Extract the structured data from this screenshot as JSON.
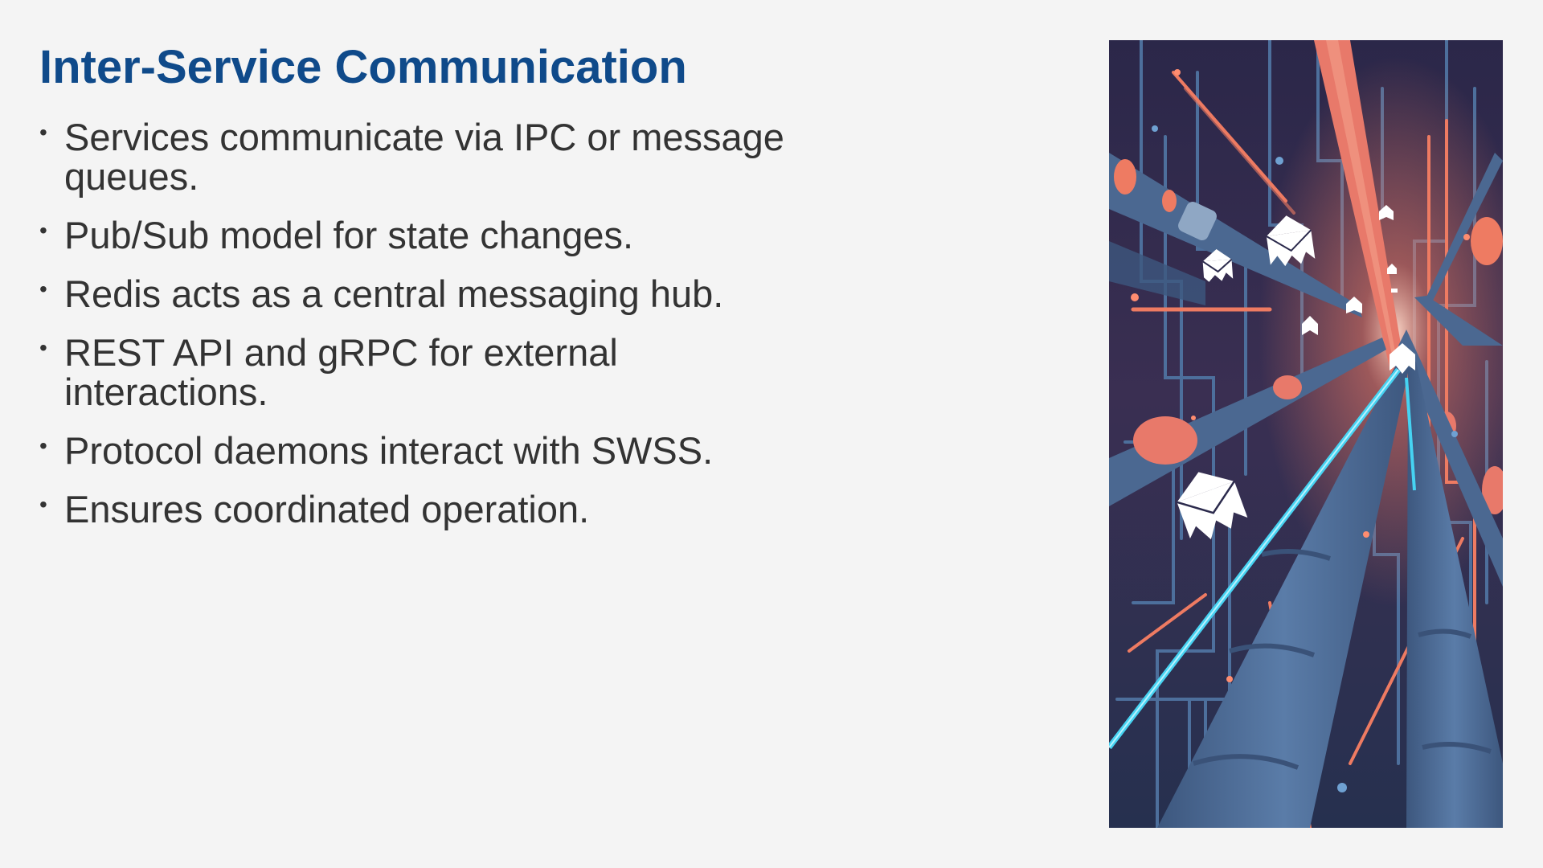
{
  "slide": {
    "title": "Inter-Service Communication",
    "bullets": [
      "Services communicate via IPC or message queues.",
      "Pub/Sub model for state changes.",
      "Redis acts as a central messaging hub.",
      "REST API and gRPC for external interactions.",
      "Protocol daemons interact with SWSS.",
      "Ensures coordinated operation."
    ],
    "bullet_glyph": "•"
  },
  "illustration": {
    "subject": "message envelopes flying through a tunnel of pipes and circuit traces",
    "icons": [
      "envelope-icon"
    ],
    "colors": {
      "background": "#2b2a4c",
      "pipe": "#52739f",
      "pipe_dark": "#3d577e",
      "trace": "#4d6f9c",
      "accent": "#ee7b62",
      "glow": "#46d3f2",
      "envelope": "#ffffff"
    }
  },
  "colors": {
    "page_background": "#f4f4f4",
    "title": "#0f4a8a",
    "body_text": "#333333"
  }
}
